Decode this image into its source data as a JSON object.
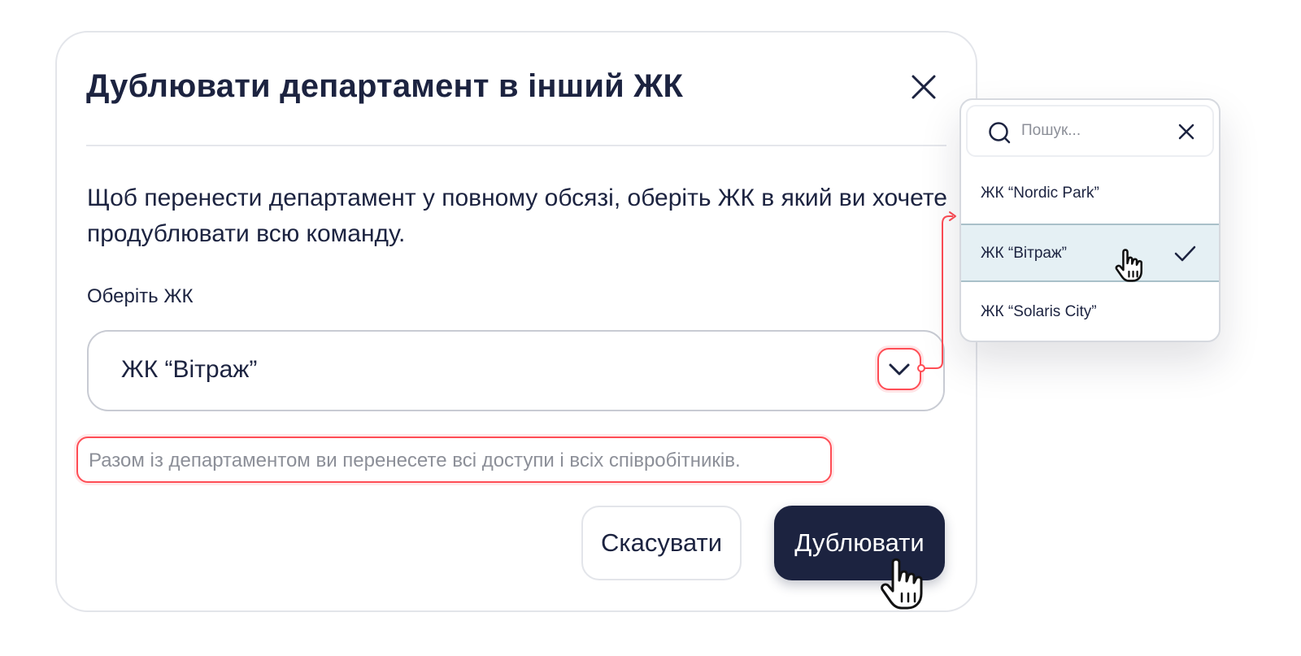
{
  "modal": {
    "title": "Дублювати департамент в інший ЖК",
    "description": "Щоб перенести департамент у повному обсязі, оберіть ЖК в який ви хочете продублювати всю команду.",
    "field_label": "Оберіть ЖК",
    "selected_value": "ЖК “Вітраж”",
    "hint": "Разом із департаментом ви перенесете всі доступи і всіх співробітників.",
    "cancel_label": "Скасувати",
    "submit_label": "Дублювати"
  },
  "dropdown": {
    "search_placeholder": "Пошук...",
    "options": [
      {
        "label": "ЖК “Nordic Park”",
        "selected": false
      },
      {
        "label": "ЖК “Вітраж”",
        "selected": true
      },
      {
        "label": "ЖК “Solaris City”",
        "selected": false
      }
    ]
  },
  "colors": {
    "primary": "#1c2340",
    "highlight": "#ff4d55",
    "selected_option_bg": "#e5f0f4",
    "muted_text": "#8c8f98",
    "border": "#e3e5ea"
  },
  "icons": {
    "close": "close-icon",
    "chevron": "chevron-down-icon",
    "search": "search-icon",
    "clear": "clear-icon",
    "check": "check-icon",
    "cursor": "hand-cursor-icon"
  }
}
